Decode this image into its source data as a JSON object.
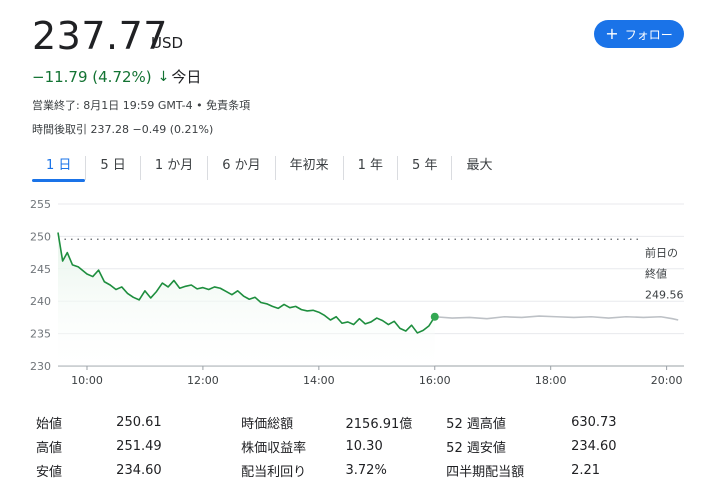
{
  "header": {
    "price": "237.77",
    "currency": "USD",
    "change": "−11.79 (4.72%)",
    "change_arrow": "↓",
    "today": "今日",
    "closing_info": "営業終了: 8月1日 19:59 GMT-4 • 免責条項",
    "after_hours_label": "時間後取引 237.28",
    "after_hours_change": "−0.49 (0.21%)",
    "follow_label": "フォロー",
    "follow_icon": "plus-icon"
  },
  "tabs": [
    {
      "label": "1 日",
      "active": true
    },
    {
      "label": "5 日",
      "active": false
    },
    {
      "label": "1 か月",
      "active": false
    },
    {
      "label": "6 か月",
      "active": false
    },
    {
      "label": "年初来",
      "active": false
    },
    {
      "label": "1 年",
      "active": false
    },
    {
      "label": "5 年",
      "active": false
    },
    {
      "label": "最大",
      "active": false
    }
  ],
  "chart_data": {
    "type": "area",
    "title": "",
    "xlabel": "",
    "ylabel": "",
    "ylim": [
      230,
      255
    ],
    "yticks": [
      255,
      250,
      245,
      240,
      235,
      230
    ],
    "xticks": [
      {
        "t": 10,
        "label": "10:00"
      },
      {
        "t": 12,
        "label": "12:00"
      },
      {
        "t": 14,
        "label": "14:00"
      },
      {
        "t": 16,
        "label": "16:00"
      },
      {
        "t": 18,
        "label": "18:00"
      },
      {
        "t": 20,
        "label": "20:00"
      }
    ],
    "xlim": [
      9.5,
      20.3
    ],
    "previous_close": 249.56,
    "previous_close_label": [
      "前日の",
      "終値",
      "249.56"
    ],
    "colors": {
      "regular": "#1e8e3e",
      "after_hours": "#bdc1c6",
      "fill": "#e6f4ea",
      "dot": "#34a853"
    },
    "series": [
      {
        "segment": "regular",
        "x": [
          9.5,
          9.58,
          9.66,
          9.75,
          9.85,
          10.0,
          10.1,
          10.2,
          10.3,
          10.4,
          10.5,
          10.6,
          10.7,
          10.8,
          10.9,
          11.0,
          11.1,
          11.2,
          11.3,
          11.4,
          11.5,
          11.6,
          11.7,
          11.8,
          11.9,
          12.0,
          12.1,
          12.2,
          12.3,
          12.4,
          12.5,
          12.6,
          12.7,
          12.8,
          12.9,
          13.0,
          13.1,
          13.2,
          13.3,
          13.4,
          13.5,
          13.6,
          13.7,
          13.8,
          13.9,
          14.0,
          14.1,
          14.2,
          14.3,
          14.4,
          14.5,
          14.6,
          14.7,
          14.8,
          14.9,
          15.0,
          15.1,
          15.2,
          15.3,
          15.4,
          15.5,
          15.6,
          15.7,
          15.8,
          15.9,
          16.0
        ],
        "y": [
          250.6,
          246.2,
          247.5,
          245.6,
          245.3,
          244.2,
          243.8,
          244.8,
          243.0,
          242.5,
          241.8,
          242.2,
          241.2,
          240.6,
          240.2,
          241.6,
          240.5,
          241.5,
          242.8,
          242.2,
          243.2,
          242.0,
          242.3,
          242.5,
          241.9,
          242.1,
          241.8,
          242.2,
          242.0,
          241.5,
          241.0,
          241.6,
          240.8,
          240.3,
          240.6,
          239.8,
          239.6,
          239.2,
          238.9,
          239.5,
          239.0,
          239.2,
          238.7,
          238.5,
          238.6,
          238.3,
          237.8,
          237.1,
          237.6,
          236.6,
          236.8,
          236.4,
          237.3,
          236.5,
          236.8,
          237.4,
          237.0,
          236.4,
          236.9,
          235.8,
          235.4,
          236.3,
          235.1,
          235.5,
          236.2,
          237.6
        ]
      },
      {
        "segment": "after_hours",
        "x": [
          16.0,
          16.3,
          16.6,
          16.9,
          17.2,
          17.5,
          17.8,
          18.1,
          18.4,
          18.7,
          19.0,
          19.3,
          19.6,
          19.9,
          20.1,
          20.2
        ],
        "y": [
          237.6,
          237.4,
          237.5,
          237.3,
          237.6,
          237.5,
          237.7,
          237.6,
          237.5,
          237.6,
          237.4,
          237.6,
          237.5,
          237.6,
          237.3,
          237.1
        ]
      }
    ]
  },
  "stats": [
    {
      "label": "始値",
      "value": "250.61",
      "label2": "時価総額",
      "value2": "2156.91億",
      "label3": "52 週高値",
      "value3": "630.73"
    },
    {
      "label": "高値",
      "value": "251.49",
      "label2": "株価収益率",
      "value2": "10.30",
      "label3": "52 週安値",
      "value3": "234.60"
    },
    {
      "label": "安値",
      "value": "234.60",
      "label2": "配当利回り",
      "value2": "3.72%",
      "label3": "四半期配当額",
      "value3": "2.21"
    }
  ]
}
